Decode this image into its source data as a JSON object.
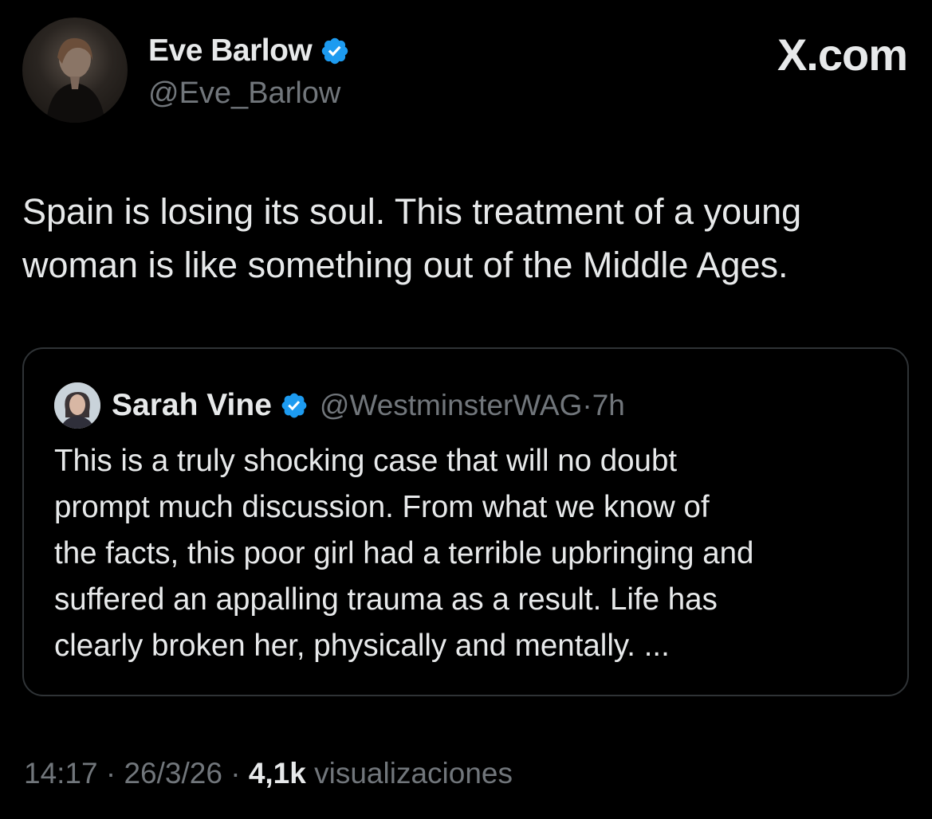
{
  "author": {
    "display_name": "Eve Barlow",
    "handle": "@Eve_Barlow",
    "verified_icon": "verified-badge-icon"
  },
  "brand": {
    "text": "X.com"
  },
  "tweet": {
    "lines": [
      "Spain is losing its soul. This treatment of a young",
      "woman is like something out of the Middle Ages."
    ]
  },
  "quoted": {
    "display_name": "Sarah Vine",
    "handle": "@WestminsterWAG",
    "separator": "·",
    "time": "7h",
    "lines": [
      "This is a truly shocking case that will no doubt",
      "prompt much discussion. From what we know of",
      "the facts, this poor girl had a terrible upbringing and",
      "suffered an appalling trauma as a result. Life has",
      "clearly broken her, physically and mentally. ..."
    ]
  },
  "meta": {
    "time": "14:17",
    "separator": "·",
    "date": "26/3/26",
    "views_count": "4,1k",
    "views_label": "visualizaciones"
  },
  "colors": {
    "background": "#000000",
    "text": "#e7e9ea",
    "secondary": "#71767b",
    "verified": "#1d9bf0",
    "border": "#2f3336"
  }
}
